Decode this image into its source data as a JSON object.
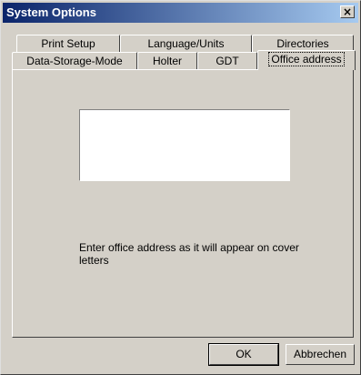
{
  "window": {
    "title": "System Options",
    "close_symbol": "×"
  },
  "tabs": {
    "row1": [
      "Print Setup",
      "Language/Units",
      "Directories"
    ],
    "row2": [
      "Data-Storage-Mode",
      "Holter",
      "GDT",
      "Office address"
    ],
    "active": "Office address"
  },
  "office_address": {
    "address_value": "",
    "hint": "Enter office address as it will appear on cover letters"
  },
  "buttons": {
    "ok": "OK",
    "cancel": "Abbrechen"
  }
}
